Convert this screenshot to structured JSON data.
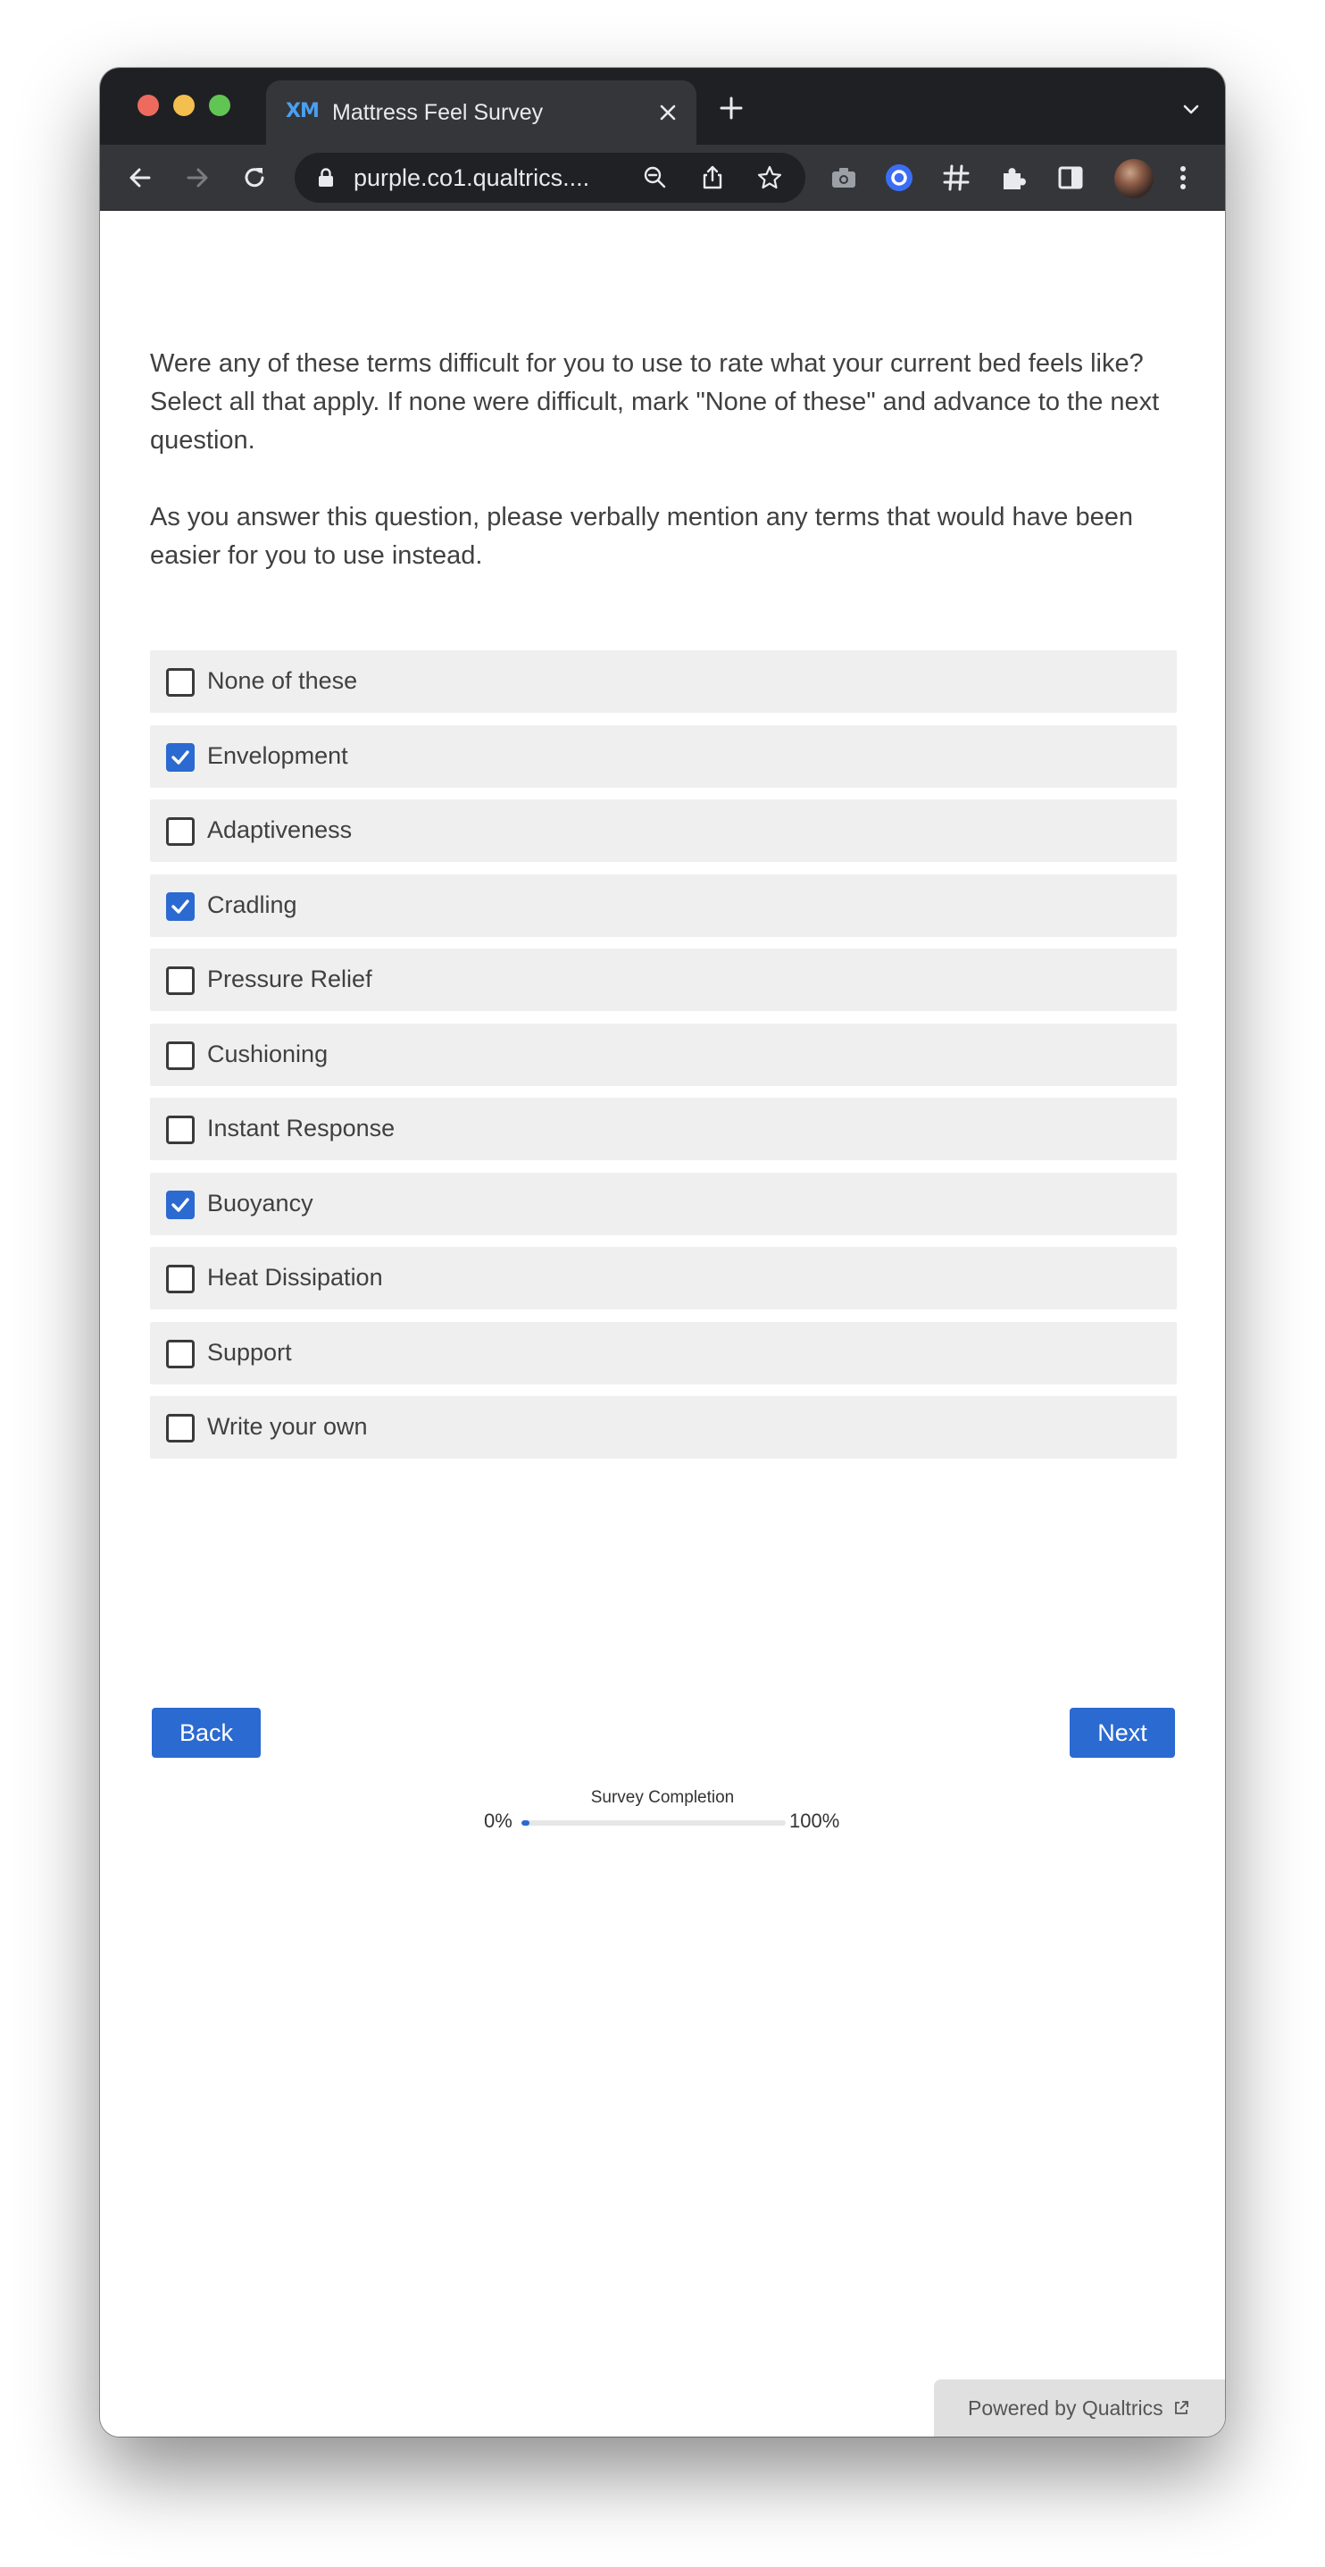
{
  "browser": {
    "tab_title": "Mattress Feel Survey",
    "tab_favicon": "XM",
    "url": "purple.co1.qualtrics....",
    "icons": [
      "back-arrow-icon",
      "forward-arrow-icon",
      "reload-icon",
      "lock-icon",
      "zoom-out-icon",
      "share-icon",
      "star-icon",
      "camera-icon",
      "extension-circle-icon",
      "hashtag-icon",
      "puzzle-icon",
      "sidepanel-icon",
      "avatar",
      "kebab-menu-icon"
    ]
  },
  "question": {
    "line1": "Were any of these terms difficult for you to use to rate what your current bed feels like?",
    "line2": "Select all that apply. If none were difficult, mark \"None of these\" and advance to the next question.",
    "line3": "As you answer this question, please verbally mention any terms that would have been easier for you to use instead."
  },
  "choices": [
    {
      "label": "None of these",
      "checked": false
    },
    {
      "label": "Envelopment",
      "checked": true
    },
    {
      "label": "Adaptiveness",
      "checked": false
    },
    {
      "label": "Cradling",
      "checked": true
    },
    {
      "label": "Pressure Relief",
      "checked": false
    },
    {
      "label": "Cushioning",
      "checked": false
    },
    {
      "label": "Instant Response",
      "checked": false
    },
    {
      "label": "Buoyancy",
      "checked": true
    },
    {
      "label": "Heat Dissipation",
      "checked": false
    },
    {
      "label": "Support",
      "checked": false
    },
    {
      "label": "Write your own",
      "checked": false
    }
  ],
  "nav": {
    "back_label": "Back",
    "next_label": "Next"
  },
  "progress": {
    "title": "Survey Completion",
    "min_label": "0%",
    "max_label": "100%",
    "value_fraction": 0.03
  },
  "footer": {
    "powered_label": "Powered by Qualtrics"
  },
  "colors": {
    "accent": "#2b6ad1",
    "choice_bg": "#efefef",
    "text": "#404040"
  }
}
